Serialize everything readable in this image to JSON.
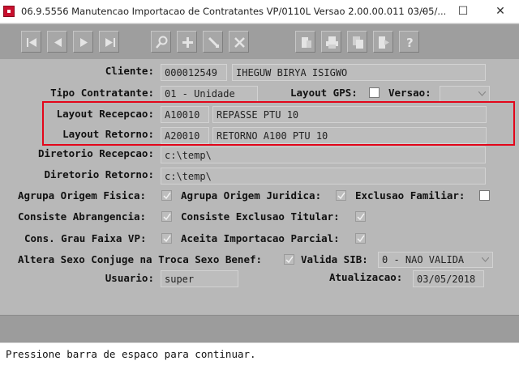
{
  "window": {
    "title": "06.9.5556 Manutencao  Importacao de Contratantes  VP/0110L Versao 2.00.00.011 03/05/...",
    "minimize": "–",
    "maximize": "☐",
    "close": "✕"
  },
  "toolbar": {
    "buttons": [
      "first-icon",
      "prev-icon",
      "next-icon",
      "last-icon",
      "search-icon",
      "add-icon",
      "edit-icon",
      "delete-icon",
      "filter-icon",
      "print-icon",
      "copy-icon",
      "exit-icon",
      "help-icon"
    ]
  },
  "form": {
    "cliente": {
      "label": "Cliente:",
      "code": "000012549",
      "name": "IHEGUW BIRYA ISIGWO"
    },
    "tipo_contratante": {
      "label": "Tipo Contratante:",
      "value": "01 - Unidade"
    },
    "layout_gps": {
      "label": "Layout GPS:",
      "checked": false
    },
    "versao": {
      "label": "Versao:",
      "value": ""
    },
    "layout_recepcao": {
      "label": "Layout Recepcao:",
      "code": "A10010",
      "desc": "REPASSE PTU 10"
    },
    "layout_retorno": {
      "label": "Layout Retorno:",
      "code": "A20010",
      "desc": "RETORNO A100 PTU 10"
    },
    "diretorio_recepcao": {
      "label": "Diretorio Recepcao:",
      "value": "c:\\temp\\"
    },
    "diretorio_retorno": {
      "label": "Diretorio Retorno:",
      "value": "c:\\temp\\"
    },
    "agrupa_origem_fisica": {
      "label": "Agrupa Origem Fisica:",
      "checked": true
    },
    "agrupa_origem_juridica": {
      "label": "Agrupa Origem Juridica:",
      "checked": true
    },
    "exclusao_familiar": {
      "label": "Exclusao Familiar:",
      "checked": false
    },
    "consiste_abrangencia": {
      "label": "Consiste Abrangencia:",
      "checked": true
    },
    "consiste_exclusao_titular": {
      "label": "Consiste Exclusao Titular:",
      "checked": true
    },
    "cons_grau_faixa_vp": {
      "label": "Cons. Grau Faixa VP:",
      "checked": true
    },
    "aceita_importacao_parcial": {
      "label": "Aceita Importacao Parcial:",
      "checked": true
    },
    "altera_sexo_conjuge": {
      "label": "Altera Sexo Conjuge na Troca Sexo Benef:",
      "checked": true
    },
    "valida_sib": {
      "label": "Valida SIB:",
      "value": "0 - NAO VALIDA"
    },
    "usuario": {
      "label": "Usuario:",
      "value": "super"
    },
    "atualizacao": {
      "label": "Atualizacao:",
      "value": "03/05/2018"
    }
  },
  "status": {
    "message": "Pressione barra de espaco para continuar."
  },
  "colors": {
    "form_bg": "#b8b8b8",
    "toolbar_bg": "#9e9e9e",
    "highlight": "#e3061a"
  }
}
